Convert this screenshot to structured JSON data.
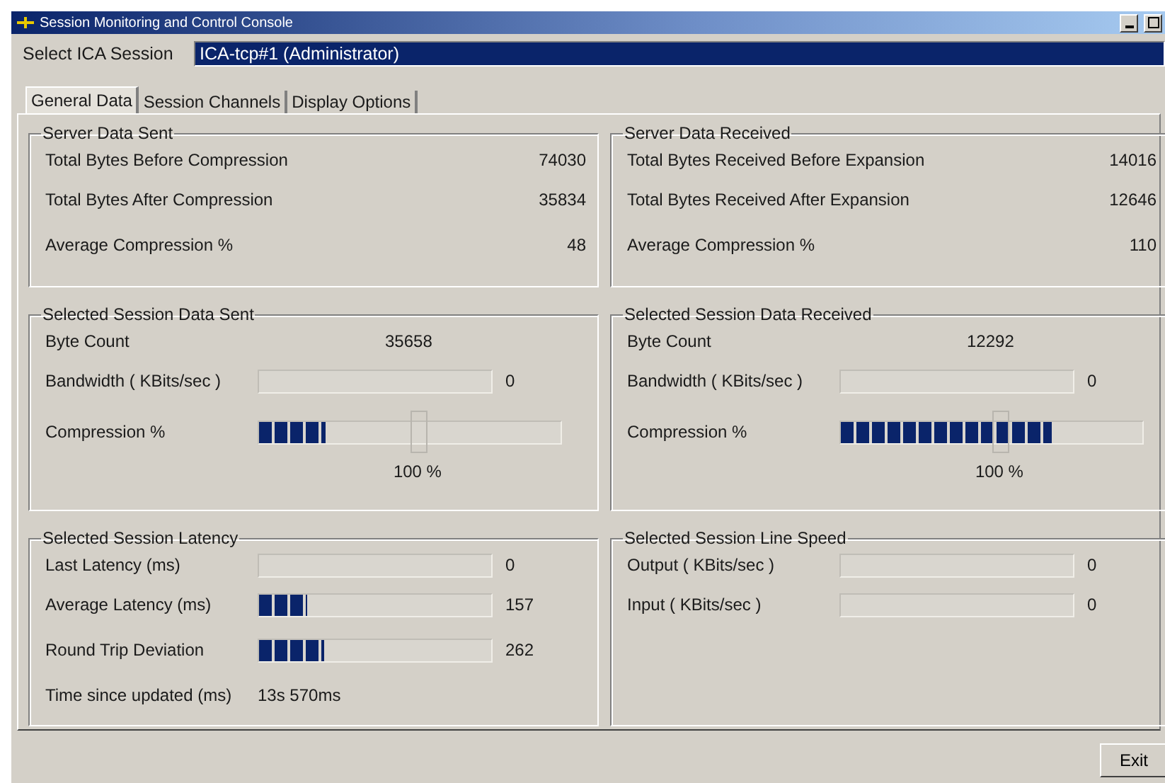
{
  "window": {
    "title": "Session Monitoring and Control Console"
  },
  "session": {
    "label": "Select ICA Session",
    "value": "ICA-tcp#1 (Administrator)"
  },
  "tabs": [
    {
      "label": "General Data",
      "selected": true
    },
    {
      "label": "Session Channels",
      "selected": false
    },
    {
      "label": "Display Options",
      "selected": false
    }
  ],
  "groups": [
    {
      "title": "Server Data Sent",
      "rows": [
        {
          "kind": "stat",
          "label": "Total Bytes Before Compression",
          "value": "74030"
        },
        {
          "kind": "stat",
          "label": "Total Bytes After Compression",
          "value": "35834"
        },
        {
          "kind": "stat",
          "label": "Average Compression %",
          "value": "48"
        }
      ]
    },
    {
      "title": "Server Data Received",
      "rows": [
        {
          "kind": "stat",
          "label": "Total Bytes Received Before Expansion",
          "value": "14016"
        },
        {
          "kind": "stat",
          "label": "Total Bytes Received After Expansion",
          "value": "12646"
        },
        {
          "kind": "stat",
          "label": "Average Compression %",
          "value": "110"
        }
      ]
    },
    {
      "title": "Selected Session Data Sent",
      "rows": [
        {
          "kind": "count",
          "label": "Byte Count",
          "value": "35658"
        },
        {
          "kind": "meter",
          "label": "Bandwidth ( KBits/sec )",
          "value": "0"
        },
        {
          "kind": "slider",
          "label": "Compression %",
          "level": 0.22,
          "threshold": {
            "level": 0.53,
            "reading": "100 %"
          }
        }
      ]
    },
    {
      "title": "Selected Session Data Received",
      "rows": [
        {
          "kind": "count",
          "label": "Byte Count",
          "value": "12292"
        },
        {
          "kind": "meter",
          "label": "Bandwidth ( KBits/sec )",
          "value": "0"
        },
        {
          "kind": "slider",
          "label": "Compression %",
          "level": 0.7,
          "threshold": {
            "level": 0.53,
            "reading": "100 %"
          }
        }
      ]
    },
    {
      "title": "Selected Session Latency",
      "rows": [
        {
          "kind": "meter",
          "label": "Last Latency (ms)",
          "value": "0"
        },
        {
          "kind": "meter",
          "label": "Average Latency (ms)",
          "level": 0.21,
          "value": "157"
        },
        {
          "kind": "meter",
          "label": "Round Trip Deviation",
          "level": 0.28,
          "value": "262"
        },
        {
          "kind": "text",
          "label": "Time since updated (ms)",
          "value": "13s 570ms"
        }
      ]
    },
    {
      "title": "Selected Session Line Speed",
      "rows": [
        {
          "kind": "meter",
          "label": "Output ( KBits/sec )",
          "value": "0"
        },
        {
          "kind": "meter",
          "label": "Input ( KBits/sec )",
          "value": "0"
        }
      ]
    }
  ],
  "buttons": [
    "Exit"
  ]
}
